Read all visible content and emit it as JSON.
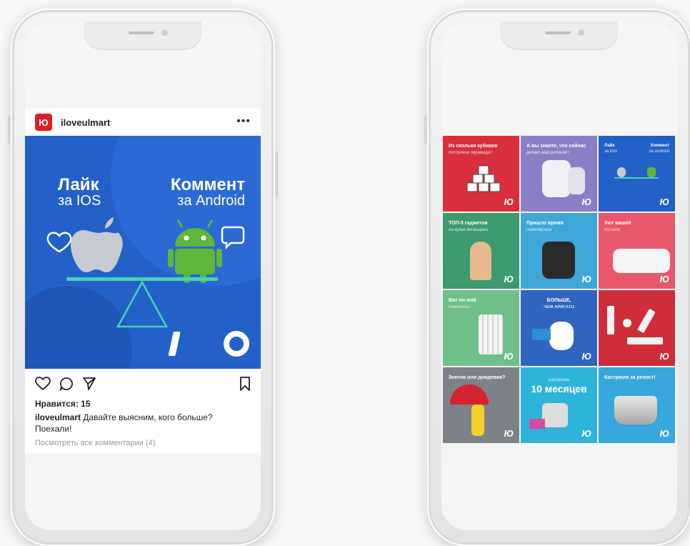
{
  "post": {
    "avatar_text": "Ю",
    "username": "iloveulmart",
    "more_icon": "•••",
    "image": {
      "like_big": "Лайк",
      "like_small": "за IOS",
      "comment_big": "Коммент",
      "comment_small": "за Android"
    },
    "likes": "Нравится: 15",
    "caption_user": "iloveulmart",
    "caption_text": " Давайте выясним, кого больше? Поехали!",
    "view_comments": "Посмотреть все комментарии (4)"
  },
  "grid": {
    "tiles": [
      {
        "title": "Из скольки кубиков",
        "subtitle": "построена пирамида?",
        "color": "#d92f3c"
      },
      {
        "title": "А вы знаете, что сейчас",
        "subtitle": "делает ваш ребенок?",
        "color": "#8a7fc7"
      },
      {
        "title": "Лайк",
        "subtitle": "за IOS",
        "title2": "Коммент",
        "subtitle2": "за Android",
        "color": "#2360c8"
      },
      {
        "title": "ТОП-5 гаджетов",
        "subtitle": "на кухне веганщика",
        "color": "#3c9a6e"
      },
      {
        "title": "Пришло время",
        "subtitle": "переобуться",
        "color": "#3fa6d8"
      },
      {
        "title": "Уют вашей",
        "subtitle": "постели",
        "color": "#e8576c"
      },
      {
        "title": "Вот он мой",
        "subtitle": "спаситель!",
        "color": "#6fbf8a"
      },
      {
        "title": "БОЛЬШЕ,",
        "subtitle": "ЧЕМ АРИГАТО",
        "color": "#2f64c0"
      },
      {
        "title": "",
        "subtitle": "",
        "color": "#cf2d3a"
      },
      {
        "title": "Зонтик или дождевик?",
        "subtitle": "",
        "color": "#7d8288"
      },
      {
        "title": "рассрочка",
        "subtitle": "10 месяцев",
        "color": "#2fb4d9"
      },
      {
        "title": "Кастрюля за репост!",
        "subtitle": "",
        "color": "#37a7dc"
      }
    ],
    "logo_text": "Ю"
  }
}
